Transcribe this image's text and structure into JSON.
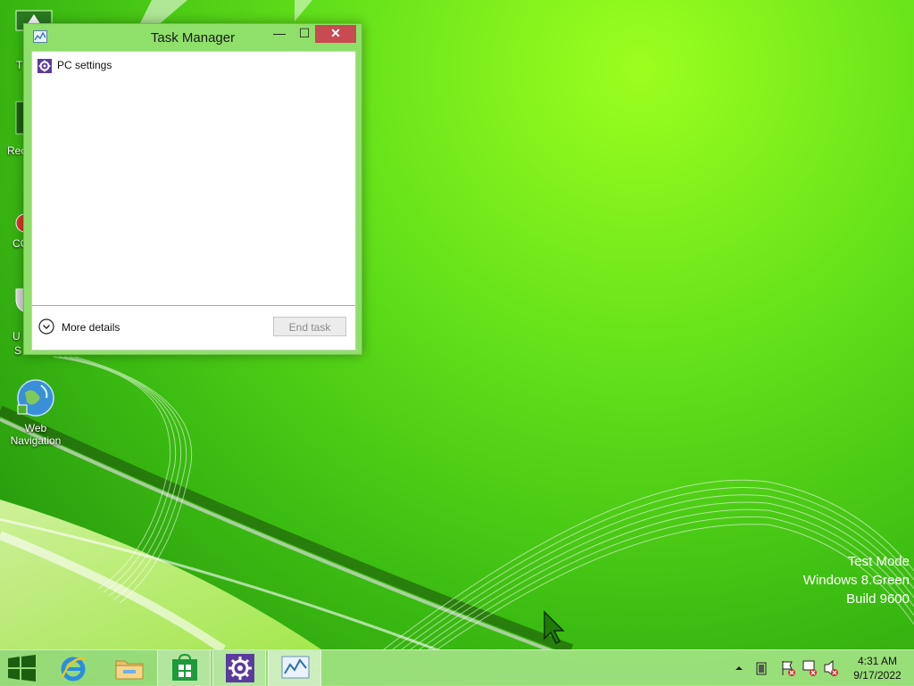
{
  "desktop": {
    "icons": [
      {
        "name": "Web Navigation",
        "line1": "Web",
        "line2": "Navigation"
      }
    ],
    "partial_labels": [
      "T",
      "Rec",
      "CC",
      "U",
      "S"
    ],
    "watermark": {
      "line1": "Test Mode",
      "line2": "Windows 8.Green",
      "line3": "Build 9600"
    }
  },
  "task_manager": {
    "title": "Task Manager",
    "minimize_label": "—",
    "maximize_label": "☐",
    "close_label": "✕",
    "apps": [
      {
        "label": "PC settings",
        "icon": "gear-icon"
      }
    ],
    "more_details_label": "More details",
    "end_task_label": "End task"
  },
  "taskbar": {
    "items": [
      {
        "name": "start",
        "icon": "windows-logo-icon"
      },
      {
        "name": "internet-explorer",
        "icon": "internet-explorer-icon"
      },
      {
        "name": "file-explorer",
        "icon": "folder-icon"
      },
      {
        "name": "store",
        "icon": "store-icon"
      },
      {
        "name": "pc-settings",
        "icon": "gear-icon"
      },
      {
        "name": "task-manager",
        "icon": "task-manager-icon"
      }
    ],
    "tray": {
      "time": "4:31 AM",
      "date": "9/17/2022"
    }
  },
  "colors": {
    "close_button": "#c74b50",
    "window_frame": "#8fe06a",
    "settings_purple": "#5a3c9c"
  }
}
